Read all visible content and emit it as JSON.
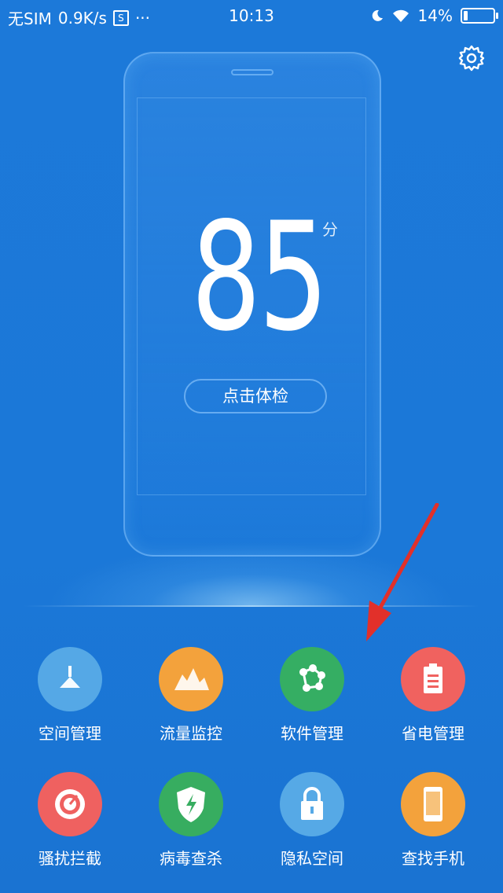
{
  "status_bar": {
    "carrier": "无SIM",
    "speed": "0.9K/s",
    "s_badge": "S",
    "more": "···",
    "time": "10:13",
    "battery": "14%",
    "battery_level": 0.14
  },
  "main": {
    "score": "85",
    "score_unit": "分",
    "check_button": "点击体检"
  },
  "tools": [
    {
      "label": "空间管理",
      "icon": "broom-icon",
      "color": "#55a8e6"
    },
    {
      "label": "流量监控",
      "icon": "traffic-chart-icon",
      "color": "#f3a23c"
    },
    {
      "label": "软件管理",
      "icon": "software-network-icon",
      "color": "#35ae63"
    },
    {
      "label": "省电管理",
      "icon": "battery-saver-icon",
      "color": "#f0625f"
    },
    {
      "label": "骚扰拦截",
      "icon": "block-call-icon",
      "color": "#ef6160"
    },
    {
      "label": "病毒查杀",
      "icon": "shield-bolt-icon",
      "color": "#37ad60"
    },
    {
      "label": "隐私空间",
      "icon": "lock-icon",
      "color": "#56a9e6"
    },
    {
      "label": "查找手机",
      "icon": "find-phone-icon",
      "color": "#f3a23c"
    }
  ],
  "colors": {
    "background": "#1b78d8",
    "arrow": "#e2302a"
  }
}
